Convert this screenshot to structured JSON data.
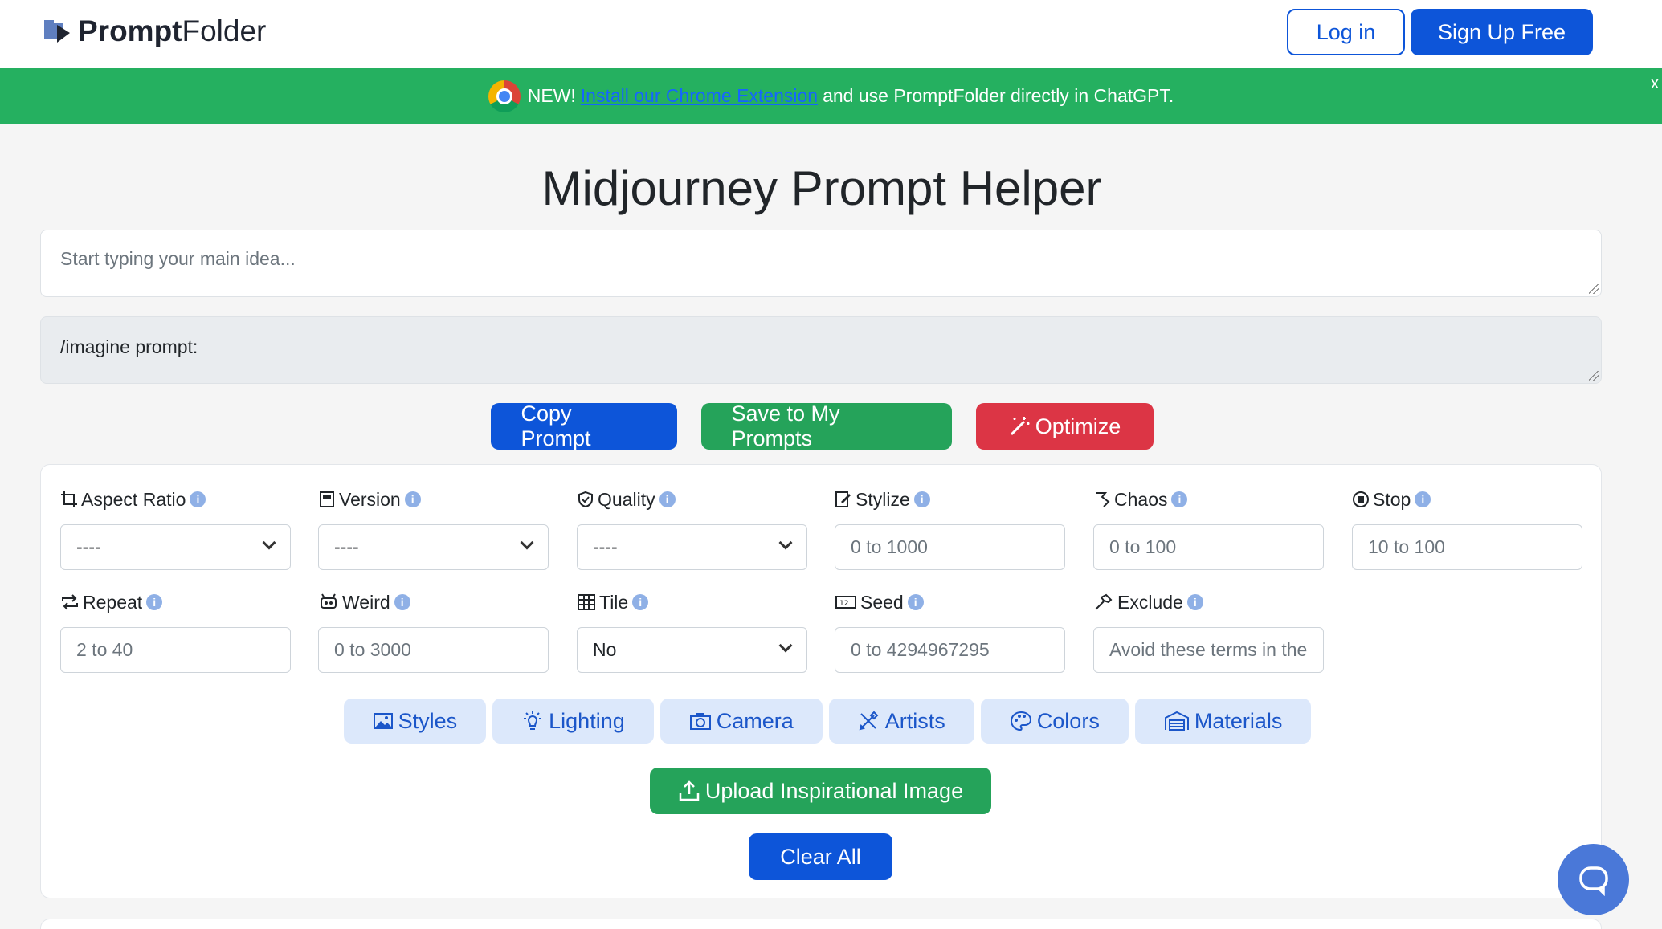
{
  "header": {
    "logo_bold": "Prompt",
    "logo_rest": "Folder",
    "login_label": "Log in",
    "signup_label": "Sign Up Free"
  },
  "banner": {
    "prefix": "NEW!",
    "link_text": "Install our Chrome Extension",
    "suffix": "and use PromptFolder directly in ChatGPT.",
    "close": "x"
  },
  "page_title": "Midjourney Prompt Helper",
  "idea_input": {
    "placeholder": "Start typing your main idea..."
  },
  "prompt_output": {
    "value": "/imagine prompt:"
  },
  "actions": {
    "copy": "Copy Prompt",
    "save": "Save to My Prompts",
    "optimize": "Optimize"
  },
  "fields": {
    "aspect_ratio": {
      "label": "Aspect Ratio",
      "value": "----"
    },
    "version": {
      "label": "Version",
      "value": "----"
    },
    "quality": {
      "label": "Quality",
      "value": "----"
    },
    "stylize": {
      "label": "Stylize",
      "placeholder": "0 to 1000"
    },
    "chaos": {
      "label": "Chaos",
      "placeholder": "0 to 100"
    },
    "stop": {
      "label": "Stop",
      "placeholder": "10 to 100"
    },
    "repeat": {
      "label": "Repeat",
      "placeholder": "2 to 40"
    },
    "weird": {
      "label": "Weird",
      "placeholder": "0 to 3000"
    },
    "tile": {
      "label": "Tile",
      "value": "No"
    },
    "seed": {
      "label": "Seed",
      "placeholder": "0 to 4294967295"
    },
    "exclude": {
      "label": "Exclude",
      "placeholder": "Avoid these terms in the"
    }
  },
  "info_glyph": "i",
  "categories": [
    "Styles",
    "Lighting",
    "Camera",
    "Artists",
    "Colors",
    "Materials"
  ],
  "upload_label": "Upload Inspirational Image",
  "clear_label": "Clear All",
  "colors": {
    "primary": "#0d55d9",
    "success": "#25a35a",
    "danger": "#dc3545",
    "banner": "#25b060"
  }
}
